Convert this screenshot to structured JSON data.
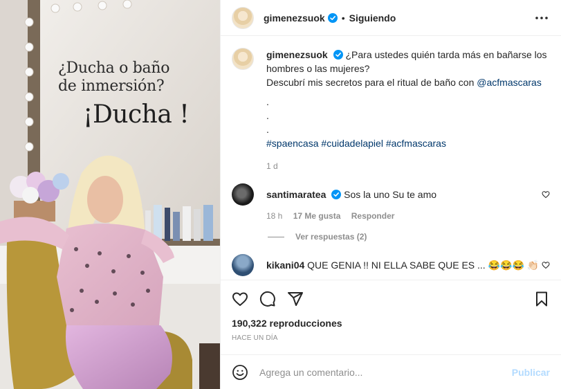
{
  "media": {
    "overlay_question_line1": "¿Ducha o baño",
    "overlay_question_line2": "de inmersión?",
    "overlay_answer": "¡Ducha !"
  },
  "header": {
    "username": "gimenezsuok",
    "separator": "•",
    "follow_status": "Siguiendo",
    "more_icon": "more-horizontal-icon"
  },
  "caption": {
    "username": "gimenezsuok",
    "line1": "¿Para ustedes quién tarda más en bañarse los",
    "line2": "hombres o las mujeres?",
    "line3_text": "Descubrí mis secretos para el ritual de baño con ",
    "line3_mention": "@acfmascaras",
    "dots": ".",
    "hashtags": [
      "#spaencasa",
      "#cuidadelapiel",
      "#acfmascaras"
    ],
    "time": "1 d"
  },
  "comments": [
    {
      "username": "santimaratea",
      "text": "Sos la uno Su te amo",
      "time": "18 h",
      "likes": "17 Me gusta",
      "reply_label": "Responder",
      "view_replies": "Ver respuestas (2)"
    },
    {
      "username": "kikani04",
      "text": "QUE GENIA !! NI ELLA SABE QUE ES ... 😂😂😂 👏🏻"
    }
  ],
  "actions": {
    "views": "190,322 reproducciones",
    "posted": "HACE UN DÍA"
  },
  "add_comment": {
    "placeholder": "Agrega un comentario...",
    "publish_label": "Publicar"
  },
  "colors": {
    "verified": "#0095f6",
    "link": "#00376b",
    "muted": "#8e8e8e",
    "publish_disabled": "#b3dbff"
  }
}
